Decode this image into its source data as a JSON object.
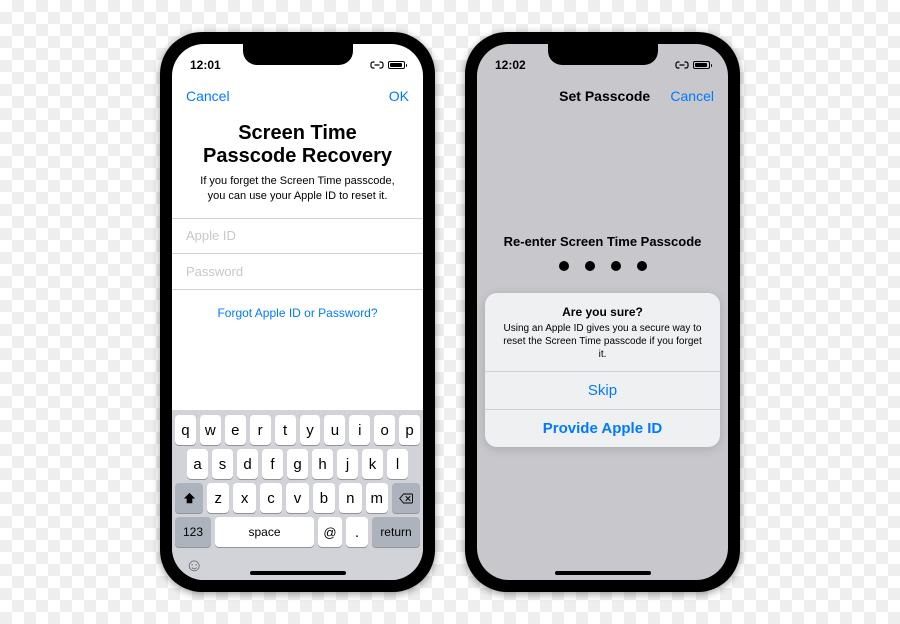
{
  "left": {
    "status": {
      "time": "12:01"
    },
    "nav": {
      "left": "Cancel",
      "right": "OK"
    },
    "title1": "Screen Time",
    "title2": "Passcode Recovery",
    "subtitle": "If you forget the Screen Time passcode, you can use your Apple ID to reset it.",
    "apple_id_placeholder": "Apple ID",
    "password_placeholder": "Password",
    "forgot": "Forgot Apple ID or Password?",
    "keyboard": {
      "row1": [
        "q",
        "w",
        "e",
        "r",
        "t",
        "y",
        "u",
        "i",
        "o",
        "p"
      ],
      "row2": [
        "a",
        "s",
        "d",
        "f",
        "g",
        "h",
        "j",
        "k",
        "l"
      ],
      "row3": [
        "z",
        "x",
        "c",
        "v",
        "b",
        "n",
        "m"
      ],
      "num": "123",
      "space": "space",
      "at": "@",
      "dot": ".",
      "return": "return"
    }
  },
  "right": {
    "status": {
      "time": "12:02"
    },
    "nav": {
      "title": "Set Passcode",
      "right": "Cancel"
    },
    "prompt": "Re-enter Screen Time Passcode",
    "sheet": {
      "title": "Are you sure?",
      "message": "Using an Apple ID gives you a secure way to reset the Screen Time passcode if you forget it.",
      "skip": "Skip",
      "provide": "Provide Apple ID"
    }
  }
}
